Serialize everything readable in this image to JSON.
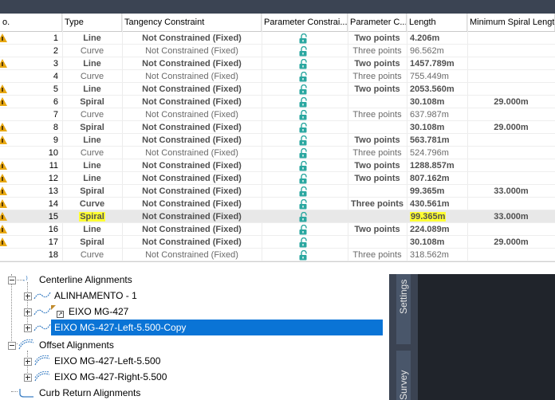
{
  "columns": [
    "o.",
    "Type",
    "Tangency Constraint",
    "Parameter Constrai...",
    "Parameter C...",
    "Length",
    "Minimum Spiral Length"
  ],
  "rows": [
    {
      "no": "1",
      "type": "Line",
      "tangency": "Not Constrained (Fixed)",
      "param": "Two points",
      "length": "4.206m",
      "minspiral": "",
      "bold": true,
      "warn": true
    },
    {
      "no": "2",
      "type": "Curve",
      "tangency": "Not Constrained (Fixed)",
      "param": "Three points",
      "length": "96.562m",
      "minspiral": "",
      "bold": false,
      "warn": false
    },
    {
      "no": "3",
      "type": "Line",
      "tangency": "Not Constrained (Fixed)",
      "param": "Two points",
      "length": "1457.789m",
      "minspiral": "",
      "bold": true,
      "warn": true
    },
    {
      "no": "4",
      "type": "Curve",
      "tangency": "Not Constrained (Fixed)",
      "param": "Three points",
      "length": "755.449m",
      "minspiral": "",
      "bold": false,
      "warn": false
    },
    {
      "no": "5",
      "type": "Line",
      "tangency": "Not Constrained (Fixed)",
      "param": "Two points",
      "length": "2053.560m",
      "minspiral": "",
      "bold": true,
      "warn": true
    },
    {
      "no": "6",
      "type": "Spiral",
      "tangency": "Not Constrained (Fixed)",
      "param": "",
      "length": "30.108m",
      "minspiral": "29.000m",
      "bold": true,
      "warn": true
    },
    {
      "no": "7",
      "type": "Curve",
      "tangency": "Not Constrained (Fixed)",
      "param": "Three points",
      "length": "637.987m",
      "minspiral": "",
      "bold": false,
      "warn": false
    },
    {
      "no": "8",
      "type": "Spiral",
      "tangency": "Not Constrained (Fixed)",
      "param": "",
      "length": "30.108m",
      "minspiral": "29.000m",
      "bold": true,
      "warn": true
    },
    {
      "no": "9",
      "type": "Line",
      "tangency": "Not Constrained (Fixed)",
      "param": "Two points",
      "length": "563.781m",
      "minspiral": "",
      "bold": true,
      "warn": true
    },
    {
      "no": "10",
      "type": "Curve",
      "tangency": "Not Constrained (Fixed)",
      "param": "Three points",
      "length": "524.796m",
      "minspiral": "",
      "bold": false,
      "warn": false
    },
    {
      "no": "11",
      "type": "Line",
      "tangency": "Not Constrained (Fixed)",
      "param": "Two points",
      "length": "1288.857m",
      "minspiral": "",
      "bold": true,
      "warn": true
    },
    {
      "no": "12",
      "type": "Line",
      "tangency": "Not Constrained (Fixed)",
      "param": "Two points",
      "length": "807.162m",
      "minspiral": "",
      "bold": true,
      "warn": true
    },
    {
      "no": "13",
      "type": "Spiral",
      "tangency": "Not Constrained (Fixed)",
      "param": "",
      "length": "99.365m",
      "minspiral": "33.000m",
      "bold": true,
      "warn": true
    },
    {
      "no": "14",
      "type": "Curve",
      "tangency": "Not Constrained (Fixed)",
      "param": "Three points",
      "length": "430.561m",
      "minspiral": "",
      "bold": true,
      "warn": true
    },
    {
      "no": "15",
      "type": "Spiral",
      "tangency": "Not Constrained (Fixed)",
      "param": "",
      "length": "99.365m",
      "minspiral": "33.000m",
      "bold": true,
      "warn": true,
      "selected": true,
      "highlight": true
    },
    {
      "no": "16",
      "type": "Line",
      "tangency": "Not Constrained (Fixed)",
      "param": "Two points",
      "length": "224.089m",
      "minspiral": "",
      "bold": true,
      "warn": true
    },
    {
      "no": "17",
      "type": "Spiral",
      "tangency": "Not Constrained (Fixed)",
      "param": "",
      "length": "30.108m",
      "minspiral": "29.000m",
      "bold": true,
      "warn": true
    },
    {
      "no": "18",
      "type": "Curve",
      "tangency": "Not Constrained (Fixed)",
      "param": "Three points",
      "length": "318.562m",
      "minspiral": "",
      "bold": false,
      "warn": false
    }
  ],
  "tree": {
    "centerline_header": "Centerline Alignments",
    "items": [
      "ALINHAMENTO - 1",
      "EIXO MG-427",
      "EIXO MG-427-Left-5.500-Copy"
    ],
    "offset_header": "Offset Alignments",
    "offset_items": [
      "EIXO MG-427-Left-5.500",
      "EIXO MG-427-Right-5.500"
    ],
    "curb_header": "Curb Return Alignments"
  },
  "side_tabs": {
    "settings": "Settings",
    "survey": "Survey"
  },
  "colors": {
    "accent": "#0a74d6",
    "warning": "#e8a813",
    "highlight": "#ffff33",
    "lock": "#2aa7a0"
  }
}
